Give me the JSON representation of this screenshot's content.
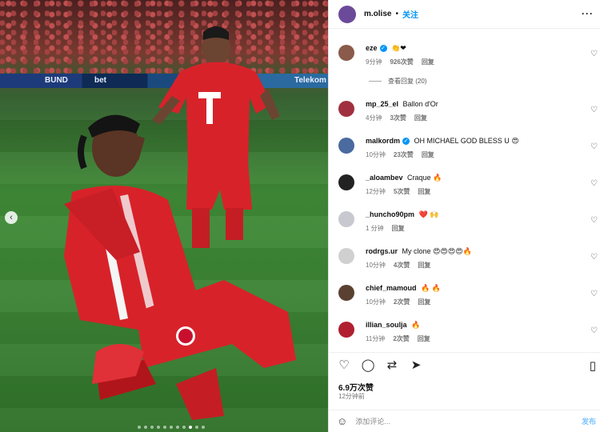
{
  "header": {
    "username": "m.olise",
    "separator": "•",
    "follow_label": "关注",
    "more": "···"
  },
  "photo": {
    "board1": "BUND",
    "board2": "bet",
    "board3": "Telekom"
  },
  "comments": [
    {
      "user": "eze",
      "verified": true,
      "text": "👏❤",
      "time": "9分钟",
      "likes": "926次赞",
      "reply": "回复",
      "avatar_color": "#8a5a4a"
    },
    {
      "user": "mp_25_el",
      "verified": false,
      "text": "Ballon d'Or",
      "time": "4分钟",
      "likes": "3次赞",
      "reply": "回复",
      "avatar_color": "#a03040"
    },
    {
      "user": "malkordm",
      "verified": true,
      "text": "OH MICHAEL GOD BLESS U 😍",
      "time": "10分钟",
      "likes": "23次赞",
      "reply": "回复",
      "avatar_color": "#4a6aa0"
    },
    {
      "user": "_aloambev",
      "verified": false,
      "text": "Craque 🔥",
      "time": "12分钟",
      "likes": "5次赞",
      "reply": "回复",
      "avatar_color": "#222222"
    },
    {
      "user": "_huncho90pm",
      "verified": false,
      "text": "❤️ 🙌",
      "time": "1 分钟",
      "likes": "",
      "reply": "回复",
      "avatar_color": "#c8c8d0"
    },
    {
      "user": "rodrgs.ur",
      "verified": false,
      "text": "My clone 😍😍😍😍🔥",
      "time": "10分钟",
      "likes": "4次赞",
      "reply": "回复",
      "avatar_color": "#d0d0d0"
    },
    {
      "user": "chief_mamoud",
      "verified": false,
      "text": "🔥 🔥",
      "time": "10分钟",
      "likes": "2次赞",
      "reply": "回复",
      "avatar_color": "#5a4030"
    },
    {
      "user": "illian_soulja",
      "verified": false,
      "text": "🔥",
      "time": "11分钟",
      "likes": "2次赞",
      "reply": "回复",
      "avatar_color": "#b02030"
    }
  ],
  "view_replies": "查看回复 (20)",
  "likes_total": "6.9万次赞",
  "post_time": "12分钟前",
  "add_comment": {
    "placeholder": "添加评论...",
    "post": "发布"
  }
}
